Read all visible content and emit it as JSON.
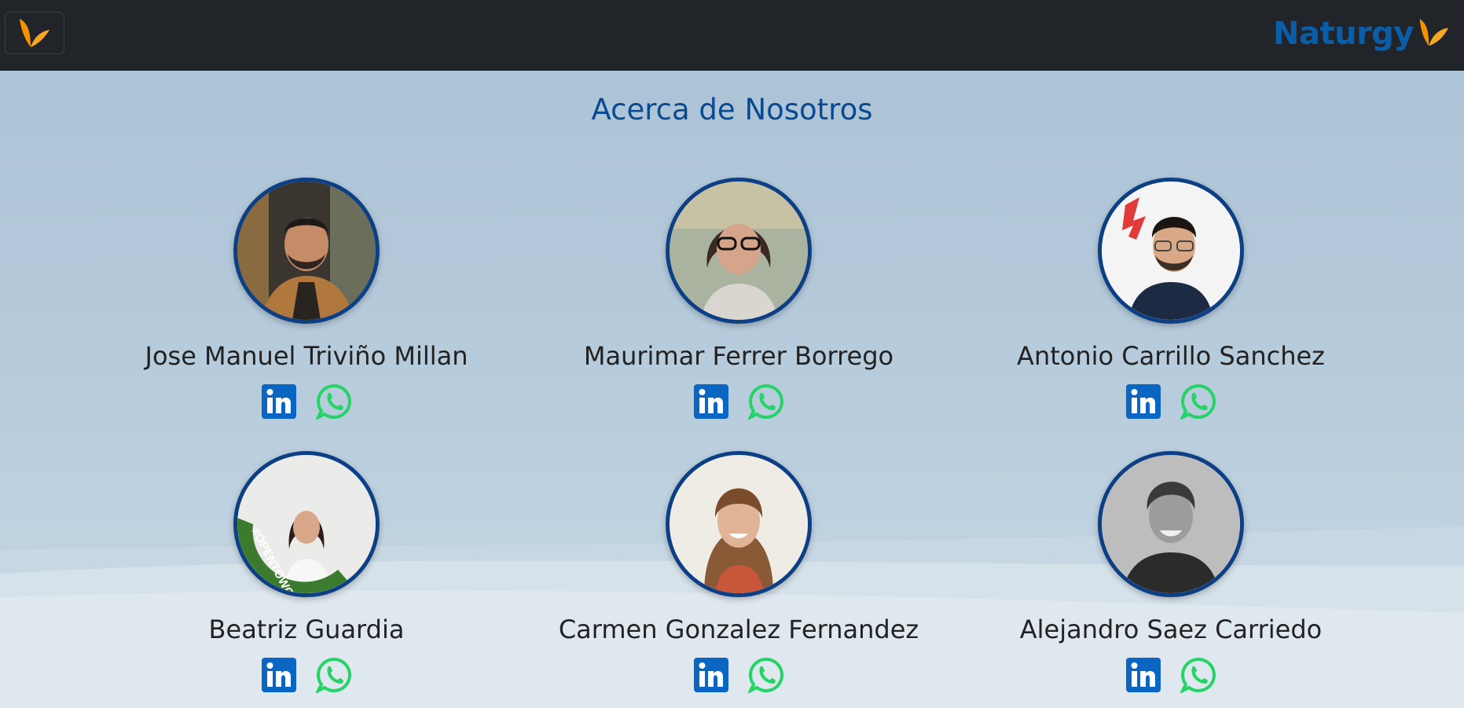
{
  "header": {
    "brand_name": "Naturgy",
    "menu_icon": "naturgy-butterfly-icon",
    "brand_color": "#0c5da7",
    "accent_color": "#f39200"
  },
  "page": {
    "title": "Acerca de Nosotros"
  },
  "team": [
    {
      "name": "Jose Manuel Triviño Millan",
      "photo": "avatar-photo"
    },
    {
      "name": "Maurimar Ferrer Borrego",
      "photo": "avatar-photo"
    },
    {
      "name": "Antonio Carrillo Sanchez",
      "photo": "avatar-photo"
    },
    {
      "name": "Beatriz Guardia",
      "photo": "avatar-photo",
      "badge_text": "#OPENTOWORK"
    },
    {
      "name": "Carmen Gonzalez Fernandez",
      "photo": "avatar-photo"
    },
    {
      "name": "Alejandro Saez Carriedo",
      "photo": "avatar-photo"
    }
  ],
  "social_icons": [
    "linkedin-icon",
    "whatsapp-icon"
  ],
  "colors": {
    "navbar": "#212429",
    "title": "#0a4a8f",
    "avatar_border": "#0d3f85",
    "linkedin": "#0a66c2",
    "whatsapp": "#25d366"
  }
}
